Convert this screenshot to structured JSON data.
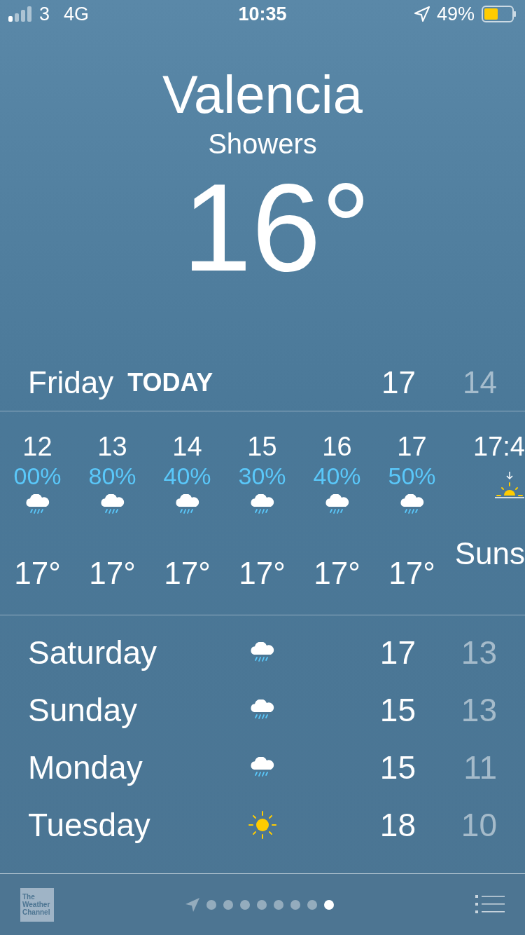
{
  "status_bar": {
    "carrier": "3",
    "network": "4G",
    "time": "10:35",
    "battery": "49%"
  },
  "location": {
    "city": "Valencia",
    "condition": "Showers",
    "temperature": "16°"
  },
  "today": {
    "day": "Friday",
    "label": "TODAY",
    "high": "17",
    "low": "14"
  },
  "hourly": [
    {
      "kind": "hour",
      "time": "12",
      "chance": "00%",
      "temp": "17°"
    },
    {
      "kind": "hour",
      "time": "13",
      "chance": "80%",
      "temp": "17°"
    },
    {
      "kind": "hour",
      "time": "14",
      "chance": "40%",
      "temp": "17°"
    },
    {
      "kind": "hour",
      "time": "15",
      "chance": "30%",
      "temp": "17°"
    },
    {
      "kind": "hour",
      "time": "16",
      "chance": "40%",
      "temp": "17°"
    },
    {
      "kind": "hour",
      "time": "17",
      "chance": "50%",
      "temp": "17°"
    },
    {
      "kind": "sunset",
      "time": "17:4",
      "label": "Suns"
    }
  ],
  "daily": [
    {
      "day": "Saturday",
      "kind": "rain",
      "high": "17",
      "low": "13"
    },
    {
      "day": "Sunday",
      "kind": "rain",
      "high": "15",
      "low": "13"
    },
    {
      "day": "Monday",
      "kind": "rain",
      "high": "15",
      "low": "11"
    },
    {
      "day": "Tuesday",
      "kind": "sun",
      "high": "18",
      "low": "10"
    }
  ],
  "footer": {
    "logo": [
      "The",
      "Weather",
      "Channel"
    ]
  },
  "pages": [
    {
      "kind": "location",
      "selected": false
    },
    {
      "kind": "dot",
      "selected": false
    },
    {
      "kind": "dot",
      "selected": false
    },
    {
      "kind": "dot",
      "selected": false
    },
    {
      "kind": "dot",
      "selected": false
    },
    {
      "kind": "dot",
      "selected": false
    },
    {
      "kind": "dot",
      "selected": false
    },
    {
      "kind": "dot",
      "selected": false
    },
    {
      "kind": "dot",
      "selected": true
    }
  ]
}
